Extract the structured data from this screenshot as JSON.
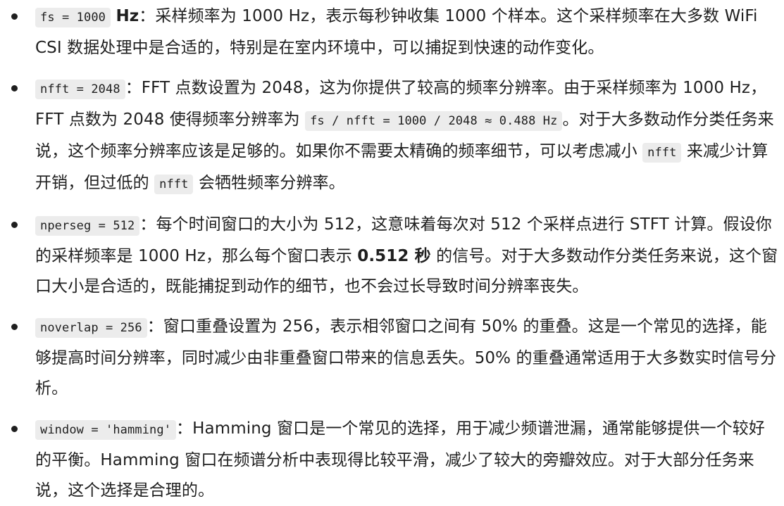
{
  "items": [
    {
      "code": "fs = 1000",
      "unit": "Hz",
      "text": "：采样频率为 1000 Hz，表示每秒钟收集 1000 个样本。这个采样频率在大多数 WiFi CSI 数据处理中是合适的，特别是在室内环境中，可以捕捉到快速的动作变化。"
    },
    {
      "code": "nfft = 2048",
      "text_a": "：FFT 点数设置为 2048，这为你提供了较高的频率分辨率。由于采样频率为 1000 Hz，FFT 点数为 2048 使得频率分辨率为 ",
      "code_b": "fs / nfft = 1000 / 2048 ≈ 0.488 Hz",
      "text_b": "。对于大多数动作分类任务来说，这个频率分辨率应该是足够的。如果你不需要太精确的频率细节，可以考虑减小 ",
      "code_c": "nfft",
      "text_c": " 来减少计算开销，但过低的 ",
      "code_d": "nfft",
      "text_d": " 会牺牲频率分辨率。"
    },
    {
      "code": "nperseg = 512",
      "text_a": "：每个时间窗口的大小为 512，这意味着每次对 512 个采样点进行 STFT 计算。假设你的采样频率是 1000 Hz，那么每个窗口表示 ",
      "bold": "0.512 秒",
      "text_b": " 的信号。对于大多数动作分类任务来说，这个窗口大小是合适的，既能捕捉到动作的细节，也不会过长导致时间分辨率丧失。"
    },
    {
      "code": "noverlap = 256",
      "text": "：窗口重叠设置为 256，表示相邻窗口之间有 50% 的重叠。这是一个常见的选择，能够提高时间分辨率，同时减少由非重叠窗口带来的信息丢失。50% 的重叠通常适用于大多数实时信号分析。"
    },
    {
      "code": "window = 'hamming'",
      "text": "：Hamming 窗口是一个常见的选择，用于减少频谱泄漏，通常能够提供一个较好的平衡。Hamming 窗口在频谱分析中表现得比较平滑，减少了较大的旁瓣效应。对于大部分任务来说，这个选择是合理的。"
    }
  ]
}
